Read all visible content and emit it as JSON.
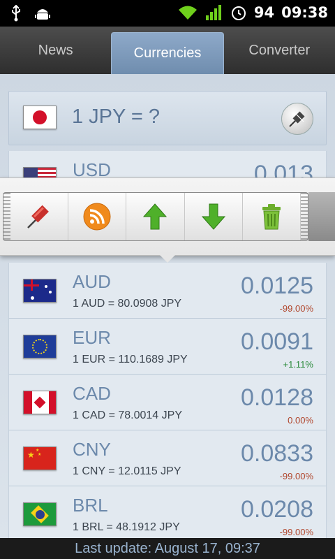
{
  "status_bar": {
    "battery": "94",
    "time": "09:38"
  },
  "tabs": [
    {
      "label": "News",
      "active": false
    },
    {
      "label": "Currencies",
      "active": true
    },
    {
      "label": "Converter",
      "active": false
    }
  ],
  "base": {
    "flag": "japan-flag",
    "label": "1 JPY = ?"
  },
  "rows": [
    {
      "code": "USD",
      "rate_line": "",
      "value": "0.013",
      "change": "",
      "flag": "usa-flag"
    },
    {
      "code": "AUD",
      "rate_line": "1 AUD = 80.0908 JPY",
      "value": "0.0125",
      "change": "-99.00%",
      "change_color": "#b0452b",
      "flag": "australia-flag"
    },
    {
      "code": "EUR",
      "rate_line": "1 EUR = 110.1689 JPY",
      "value": "0.0091",
      "change": "+1.11%",
      "change_color": "#2a8a3a",
      "flag": "eu-flag"
    },
    {
      "code": "CAD",
      "rate_line": "1 CAD = 78.0014 JPY",
      "value": "0.0128",
      "change": "0.00%",
      "change_color": "#b0452b",
      "flag": "canada-flag"
    },
    {
      "code": "CNY",
      "rate_line": "1 CNY = 12.0115 JPY",
      "value": "0.0833",
      "change": "-99.00%",
      "change_color": "#b0452b",
      "flag": "china-flag"
    },
    {
      "code": "BRL",
      "rate_line": "1 BRL = 48.1912 JPY",
      "value": "0.0208",
      "change": "-99.00%",
      "change_color": "#b0452b",
      "flag": "brazil-flag"
    }
  ],
  "toolbar": {
    "icons": [
      "pin-icon",
      "rss-icon",
      "move-up-icon",
      "move-down-icon",
      "trash-icon"
    ]
  },
  "footer": {
    "text": "Last update: August 17, 09:37"
  },
  "colors": {
    "accent": "#6c89ab",
    "negative": "#b0452b",
    "positive": "#2a8a3a"
  }
}
